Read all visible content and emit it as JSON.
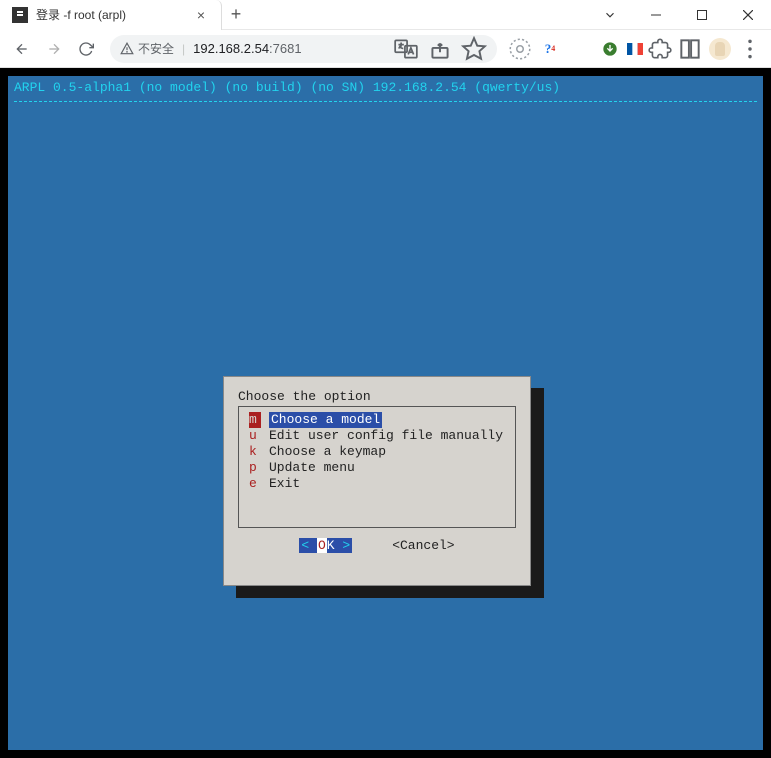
{
  "browser": {
    "tab_title": "登录 -f root (arpl)",
    "not_secure_label": "不安全",
    "url_host": "192.168.2.54",
    "url_port": ":7681"
  },
  "window_controls": {
    "dropdown": "⌄",
    "minimize": "—",
    "maximize": "▢",
    "close": "✕"
  },
  "terminal": {
    "header": "ARPL 0.5-alpha1 (no model) (no build) (no SN) 192.168.2.54 (qwerty/us)"
  },
  "dialog": {
    "title": "Choose the option",
    "items": [
      {
        "key": "m",
        "label": "Choose a model",
        "selected": true
      },
      {
        "key": "u",
        "label": "Edit user config file manually",
        "selected": false
      },
      {
        "key": "k",
        "label": "Choose a keymap",
        "selected": false
      },
      {
        "key": "p",
        "label": "Update menu",
        "selected": false
      },
      {
        "key": "e",
        "label": "Exit",
        "selected": false
      }
    ],
    "ok_prefix": "<  ",
    "ok_hot": "O",
    "ok_rest": "K",
    "ok_suffix": "  >",
    "cancel": "<Cancel>"
  }
}
